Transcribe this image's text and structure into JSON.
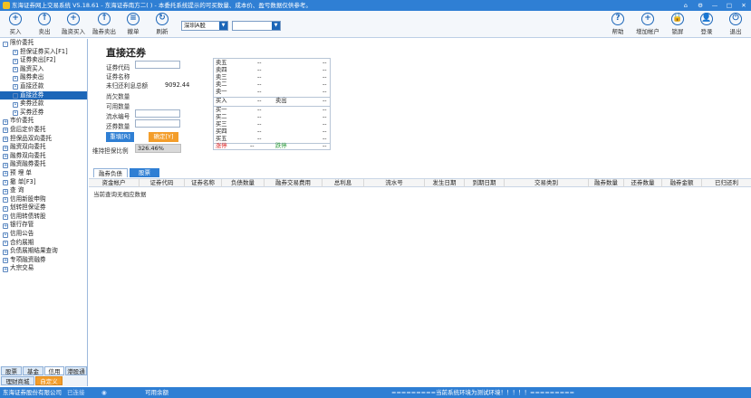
{
  "window": {
    "title": "东海证券网上交易系统 V5.18.61 - 东海证券南方二(        ) - 本委托系统提示的可买数量、成本价、盈亏数据仅供参考。",
    "controls": [
      "⌂",
      "⚙",
      "—",
      "□",
      "✕"
    ]
  },
  "toolbar": {
    "left_buttons": [
      {
        "label": "买入",
        "icon": "+"
      },
      {
        "label": "卖出",
        "icon": "↑"
      },
      {
        "label": "融资买入",
        "icon": "+"
      },
      {
        "label": "融券卖出",
        "icon": "↑"
      },
      {
        "label": "撤单",
        "icon": "≡"
      },
      {
        "label": "刷新",
        "icon": "↻"
      }
    ],
    "market_select": "深圳A股",
    "account_select": "",
    "right_buttons": [
      {
        "label": "帮助",
        "icon": "?"
      },
      {
        "label": "增加帐户",
        "icon": "+"
      },
      {
        "label": "锁屏",
        "icon": "🔒"
      },
      {
        "label": "登录",
        "icon": "👤"
      },
      {
        "label": "退出",
        "icon": "⏻"
      }
    ]
  },
  "sidebar": {
    "items": [
      {
        "label": "限价委托",
        "level": 0,
        "icon": "-"
      },
      {
        "label": "担保证券买入[F1]",
        "level": 1,
        "icon": "•"
      },
      {
        "label": "证券卖出[F2]",
        "level": 1,
        "icon": "•"
      },
      {
        "label": "融资买入",
        "level": 1,
        "icon": "•"
      },
      {
        "label": "融券卖出",
        "level": 1,
        "icon": "•"
      },
      {
        "label": "直接还款",
        "level": 1,
        "icon": "•"
      },
      {
        "label": "直接还券",
        "level": 1,
        "icon": "•",
        "selected": true
      },
      {
        "label": "卖券还款",
        "level": 1,
        "icon": "•"
      },
      {
        "label": "买券还券",
        "level": 1,
        "icon": "•"
      },
      {
        "label": "市价委托",
        "level": 0,
        "icon": "+"
      },
      {
        "label": "盘后定价委托",
        "level": 0,
        "icon": "+"
      },
      {
        "label": "担保品双向委托",
        "level": 0,
        "icon": "+"
      },
      {
        "label": "融资双向委托",
        "level": 0,
        "icon": "+"
      },
      {
        "label": "融券双向委托",
        "level": 0,
        "icon": "+"
      },
      {
        "label": "融资融券委托",
        "level": 0,
        "icon": "+"
      },
      {
        "label": "预 埋 单",
        "level": 0,
        "icon": "+"
      },
      {
        "label": "撤      单[F3]",
        "level": 0,
        "icon": "•"
      },
      {
        "label": "查      询",
        "level": 0,
        "icon": "+"
      },
      {
        "label": "信用新股申购",
        "level": 0,
        "icon": "•"
      },
      {
        "label": "划转担保证券",
        "level": 0,
        "icon": "•"
      },
      {
        "label": "信用转债转股",
        "level": 0,
        "icon": "•"
      },
      {
        "label": "银行存管",
        "level": 0,
        "icon": "+"
      },
      {
        "label": "信用公告",
        "level": 0,
        "icon": "•"
      },
      {
        "label": "合约展期",
        "level": 0,
        "icon": "•"
      },
      {
        "label": "负债展期结果查询",
        "level": 0,
        "icon": "+"
      },
      {
        "label": "专项融资融券",
        "level": 0,
        "icon": "+"
      },
      {
        "label": "大宗交易",
        "level": 0,
        "icon": "+"
      }
    ]
  },
  "bottom_tabs": {
    "row1": [
      "股票",
      "基金",
      "信用",
      "港股通"
    ],
    "row2": [
      "理财商城",
      "自定义"
    ]
  },
  "form": {
    "title": "直接还券",
    "labels": {
      "code": "证券代码",
      "name": "证券名称",
      "uncleared_interest": "未归还利息总额",
      "owed_qty": "尚欠数量",
      "available_qty": "可用数量",
      "serial_no": "流水编号",
      "return_qty": "还券数量",
      "ratio": "维持担保比例"
    },
    "uncleared_interest_value": "9092.44",
    "ratio_value": "326.46%",
    "reset_button": "重填[R]",
    "confirm_button": "确定[Y]"
  },
  "quote": {
    "sell_rows": [
      "卖五",
      "卖四",
      "卖三",
      "卖二",
      "卖一"
    ],
    "buy_rows": [
      "买一",
      "买二",
      "买三",
      "买四",
      "买五"
    ],
    "dash": "--",
    "header_buy": "买入",
    "header_sell": "卖出",
    "limit_down": "涨停",
    "limit_up": "跌停"
  },
  "tabs": [
    "融券负债",
    "股票"
  ],
  "grid": {
    "columns": [
      "资金帐户",
      "证券代码",
      "证券名称",
      "负债数量",
      "融券交易费用",
      "总利息",
      "流水号",
      "发生日期",
      "到期日期",
      "交易类别",
      "融券数量",
      "还券数量",
      "融券金额",
      "已归还利"
    ],
    "empty_message": "当前查询无相应数据"
  },
  "status": {
    "company": "东海证券股份有限公司",
    "status_badge": "已连接",
    "available_label": "可用余额",
    "available_value": "",
    "notice": "=========当前系统环境为测试环境！！！！！========="
  }
}
